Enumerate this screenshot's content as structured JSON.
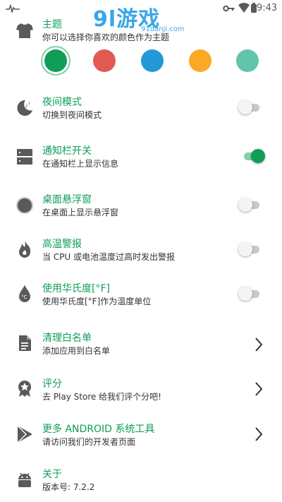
{
  "status_bar": {
    "time": "9:43"
  },
  "watermark": {
    "main": "9l游戏",
    "sub": "91danji.com"
  },
  "theme": {
    "title": "主题",
    "subtitle": "你可以选择你喜欢的颜色作为主题",
    "colors": [
      "#0f9d58",
      "#e05a51",
      "#2299d6",
      "#fba824",
      "#63c4ac"
    ]
  },
  "settings": {
    "night_mode": {
      "title": "夜间模式",
      "subtitle": "切换到夜间模式",
      "enabled": false
    },
    "notification": {
      "title": "通知栏开关",
      "subtitle": "在通知栏上显示信息",
      "enabled": true
    },
    "float_window": {
      "title": "桌面悬浮窗",
      "subtitle": "在桌面上显示悬浮窗",
      "enabled": false
    },
    "high_temp": {
      "title": "高温警报",
      "subtitle": "当 CPU 或电池温度过高时发出警报",
      "enabled": false
    },
    "fahrenheit": {
      "title": "使用华氏度[°F]",
      "subtitle": "使用华氏度[°F]作为温度单位",
      "enabled": false
    },
    "whitelist": {
      "title": "清理白名单",
      "subtitle": "添加应用到白名单"
    },
    "rate": {
      "title": "评分",
      "subtitle": "去 Play Store 给我们评个分吧!"
    },
    "more_tools": {
      "title": "更多 ANDROID 系统工具",
      "subtitle": "请访问我们的开发者页面"
    },
    "about": {
      "title": "关于",
      "subtitle": "版本号: 7.2.2"
    }
  }
}
